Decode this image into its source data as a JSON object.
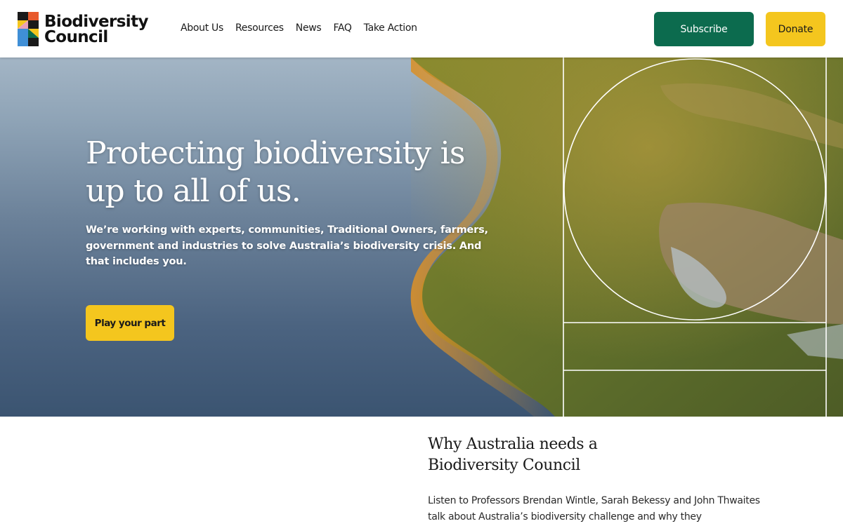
{
  "site": {
    "logo_line1": "Biodiversity",
    "logo_line2": "Council"
  },
  "nav": {
    "items": [
      {
        "label": "About Us"
      },
      {
        "label": "Resources"
      },
      {
        "label": "News"
      },
      {
        "label": "FAQ"
      },
      {
        "label": "Take Action"
      }
    ]
  },
  "header": {
    "subscribe_label": "Subscribe",
    "donate_label": "Donate"
  },
  "hero": {
    "title": "Protecting biodiversity is up to all of us.",
    "subtitle": "We’re working with experts, communities, Traditional Owners, farmers, government and industries to solve Australia’s biodiversity crisis. And that includes you.",
    "cta_label": "Play your part"
  },
  "section": {
    "title": "Why Australia needs a Biodiversity Council",
    "body": "Listen to Professors Brendan Wintle, Sarah Bekessy and John Thwaites talk about Australia’s biodiversity challenge and why they"
  },
  "colors": {
    "primary_green": "#0c6b4e",
    "accent_yellow": "#f4c61e",
    "text_dark": "#1a1a1a"
  },
  "icons": {
    "logo": "biodiversity-council-logo-mark"
  }
}
